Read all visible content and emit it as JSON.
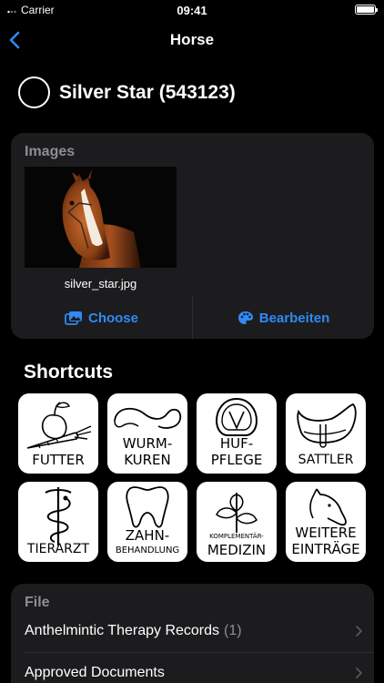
{
  "status_bar": {
    "carrier": "Carrier",
    "time": "09:41",
    "battery_level": 1.0
  },
  "nav": {
    "title": "Horse",
    "back_icon": "chevron-left-icon"
  },
  "horse": {
    "name": "Silver Star (543123)"
  },
  "images_section": {
    "label": "Images",
    "items": [
      {
        "filename": "silver_star.jpg"
      }
    ],
    "choose_label": "Choose",
    "edit_label": "Bearbeiten"
  },
  "shortcuts": {
    "title": "Shortcuts",
    "tiles": [
      {
        "id": "futter",
        "lines": [
          "FUTTER"
        ],
        "icon": "carrot-apple-icon"
      },
      {
        "id": "wurmkuren",
        "lines": [
          "WURM-",
          "KUREN"
        ],
        "icon": "worm-icon"
      },
      {
        "id": "hufpflege",
        "lines": [
          "HUF-",
          "PFLEGE"
        ],
        "icon": "hoof-icon"
      },
      {
        "id": "sattler",
        "lines": [
          "SATTLER"
        ],
        "icon": "saddle-icon"
      },
      {
        "id": "tierarzt",
        "lines": [
          "TIERARZT"
        ],
        "icon": "caduceus-icon"
      },
      {
        "id": "zahnbehandlung",
        "lines": [
          "ZAHN-",
          "BEHANDLUNG"
        ],
        "icon": "tooth-icon"
      },
      {
        "id": "komplementaermedizin",
        "lines": [
          "KOMPLEMENTÄR-",
          "MEDIZIN"
        ],
        "icon": "plant-icon"
      },
      {
        "id": "weitere",
        "lines": [
          "WEITERE",
          "EINTRÄGE"
        ],
        "icon": "horse-head-icon"
      }
    ]
  },
  "file_section": {
    "label": "File",
    "rows": [
      {
        "text": "Anthelmintic Therapy Records",
        "count": "(1)"
      },
      {
        "text": "Approved Documents",
        "count": ""
      }
    ]
  },
  "colors": {
    "accent": "#2f8af5",
    "card": "#1c1c1e",
    "secondary_text": "#8e8e93"
  }
}
